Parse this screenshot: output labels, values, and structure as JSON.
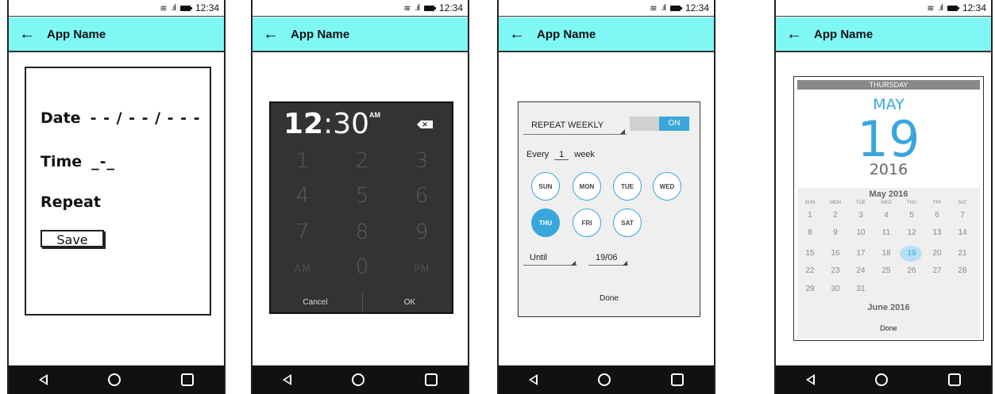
{
  "status_bar": {
    "time": "12:34"
  },
  "app_bar": {
    "title": "App Name",
    "back_icon": "arrow-left-icon"
  },
  "screen1": {
    "date_label": "Date",
    "date_value": "- - / - - / - - -",
    "time_label": "Time",
    "time_value": "_-_",
    "repeat_label": "Repeat",
    "save_button": "Save"
  },
  "screen2": {
    "hour": "12",
    "minute": ":30",
    "ampm": "AM",
    "delete_icon": "backspace-icon",
    "keys": [
      "1",
      "2",
      "3",
      "4",
      "5",
      "6",
      "7",
      "8",
      "9",
      "AM",
      "0",
      "PM"
    ],
    "cancel": "Cancel",
    "ok": "OK"
  },
  "screen3": {
    "title": "REPEAT WEEKLY",
    "toggle": "ON",
    "every_prefix": "Every",
    "every_value": "1",
    "every_suffix": "week",
    "days": [
      "SUN",
      "MON",
      "TUE",
      "WED",
      "THU",
      "FRI",
      "SAT"
    ],
    "selected_day": "THU",
    "until_label": "Until",
    "until_date": "19/06",
    "done": "Done"
  },
  "screen4": {
    "weekday": "THURSDAY",
    "month": "MAY",
    "day": "19",
    "year": "2016",
    "calendar_title": "May 2016",
    "dow": [
      "SUN",
      "MON",
      "TUE",
      "WED",
      "THU",
      "FRI",
      "SAT"
    ],
    "dates": [
      "1",
      "2",
      "3",
      "4",
      "5",
      "6",
      "7",
      "8",
      "9",
      "10",
      "11",
      "12",
      "13",
      "14",
      "15",
      "16",
      "17",
      "18",
      "19",
      "20",
      "21",
      "22",
      "23",
      "24",
      "25",
      "26",
      "27",
      "28",
      "29",
      "30",
      "31"
    ],
    "selected_date": "19",
    "next_month_title": "June 2016",
    "done": "Done"
  },
  "colors": {
    "app_bar": "#7ff7f5",
    "accent": "#3aa6dd",
    "time_picker_bg": "#333333",
    "nav_bar": "#111111"
  }
}
